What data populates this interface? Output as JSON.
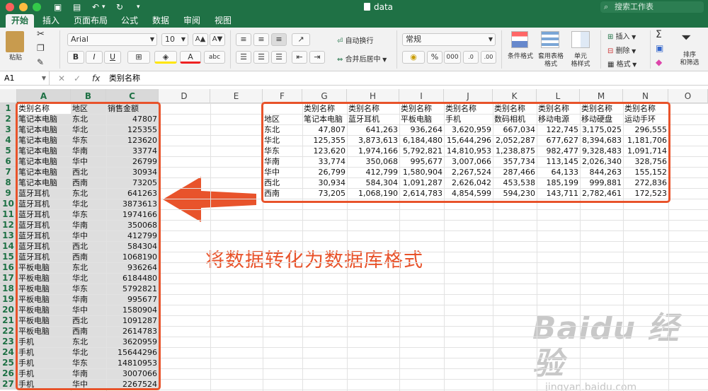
{
  "app": {
    "doc_title": "data",
    "search_placeholder": "搜索工作表"
  },
  "tabs": [
    "开始",
    "插入",
    "页面布局",
    "公式",
    "数据",
    "审阅",
    "视图"
  ],
  "ribbon": {
    "paste": "粘贴",
    "font_name": "Arial",
    "font_size": "10",
    "bold": "B",
    "italic": "I",
    "underline": "U",
    "wrap_text": "自动换行",
    "merge_center": "合并后居中",
    "number_format": "常规",
    "percent": "%",
    "thousands": "000",
    "cond_format": "条件格式",
    "table_format": "套用表格\n格式",
    "cell_styles": "单元\n格样式",
    "insert": "插入",
    "delete": "删除",
    "format": "格式",
    "sort_filter": "排序\n和筛选",
    "font_grow": "A▲",
    "font_shrink": "A▼",
    "abc": "abc"
  },
  "formula_bar": {
    "name_box": "A1",
    "fx": "fx",
    "content": "类别名称"
  },
  "columns": [
    "A",
    "B",
    "C",
    "D",
    "E",
    "F",
    "G",
    "H",
    "I",
    "J",
    "K",
    "L",
    "M",
    "N",
    "O"
  ],
  "rows": [
    "1",
    "2",
    "3",
    "4",
    "5",
    "6",
    "7",
    "8",
    "9",
    "10",
    "11",
    "12",
    "13",
    "14",
    "15",
    "16",
    "17",
    "18",
    "19",
    "20",
    "21",
    "22",
    "23",
    "24",
    "25",
    "26",
    "27"
  ],
  "left_table": {
    "header": [
      "类别名称",
      "地区",
      "销售金额"
    ],
    "rows": [
      [
        "笔记本电脑",
        "东北",
        "47807"
      ],
      [
        "笔记本电脑",
        "华北",
        "125355"
      ],
      [
        "笔记本电脑",
        "华东",
        "123620"
      ],
      [
        "笔记本电脑",
        "华南",
        "33774"
      ],
      [
        "笔记本电脑",
        "华中",
        "26799"
      ],
      [
        "笔记本电脑",
        "西北",
        "30934"
      ],
      [
        "笔记本电脑",
        "西南",
        "73205"
      ],
      [
        "蓝牙耳机",
        "东北",
        "641263"
      ],
      [
        "蓝牙耳机",
        "华北",
        "3873613"
      ],
      [
        "蓝牙耳机",
        "华东",
        "1974166"
      ],
      [
        "蓝牙耳机",
        "华南",
        "350068"
      ],
      [
        "蓝牙耳机",
        "华中",
        "412799"
      ],
      [
        "蓝牙耳机",
        "西北",
        "584304"
      ],
      [
        "蓝牙耳机",
        "西南",
        "1068190"
      ],
      [
        "平板电脑",
        "东北",
        "936264"
      ],
      [
        "平板电脑",
        "华北",
        "6184480"
      ],
      [
        "平板电脑",
        "华东",
        "5792821"
      ],
      [
        "平板电脑",
        "华南",
        "995677"
      ],
      [
        "平板电脑",
        "华中",
        "1580904"
      ],
      [
        "平板电脑",
        "西北",
        "1091287"
      ],
      [
        "平板电脑",
        "西南",
        "2614783"
      ],
      [
        "手机",
        "东北",
        "3620959"
      ],
      [
        "手机",
        "华北",
        "15644296"
      ],
      [
        "手机",
        "华东",
        "14810953"
      ],
      [
        "手机",
        "华南",
        "3007066"
      ],
      [
        "手机",
        "华中",
        "2267524"
      ]
    ]
  },
  "right_table": {
    "header_row1": [
      "",
      "类别名称",
      "类别名称",
      "类别名称",
      "类别名称",
      "类别名称",
      "类别名称",
      "类别名称",
      "类别名称"
    ],
    "header_row2": [
      "地区",
      "笔记本电脑",
      "蓝牙耳机",
      "平板电脑",
      "手机",
      "数码相机",
      "移动电源",
      "移动硬盘",
      "运动手环"
    ],
    "rows": [
      [
        "东北",
        "47,807",
        "641,263",
        "936,264",
        "3,620,959",
        "667,034",
        "122,745",
        "3,175,025",
        "296,555"
      ],
      [
        "华北",
        "125,355",
        "3,873,613",
        "6,184,480",
        "15,644,296",
        "2,052,287",
        "677,627",
        "8,394,683",
        "1,181,706"
      ],
      [
        "华东",
        "123,620",
        "1,974,166",
        "5,792,821",
        "14,810,953",
        "1,238,875",
        "982,477",
        "9,328,483",
        "1,091,714"
      ],
      [
        "华南",
        "33,774",
        "350,068",
        "995,677",
        "3,007,066",
        "357,734",
        "113,145",
        "2,026,340",
        "328,756"
      ],
      [
        "华中",
        "26,799",
        "412,799",
        "1,580,904",
        "2,267,524",
        "287,466",
        "64,133",
        "844,263",
        "155,152"
      ],
      [
        "西北",
        "30,934",
        "584,304",
        "1,091,287",
        "2,626,042",
        "453,538",
        "185,199",
        "999,881",
        "272,836"
      ],
      [
        "西南",
        "73,205",
        "1,068,190",
        "2,614,783",
        "4,854,599",
        "594,230",
        "143,711",
        "2,782,461",
        "172,523"
      ]
    ]
  },
  "annotation": "将数据转化为数据库格式",
  "watermark": {
    "main": "Baidu 经验",
    "sub": "jingyan.baidu.com"
  },
  "colors": {
    "excel_green": "#1f7145",
    "annotation_red": "#e8532b"
  }
}
